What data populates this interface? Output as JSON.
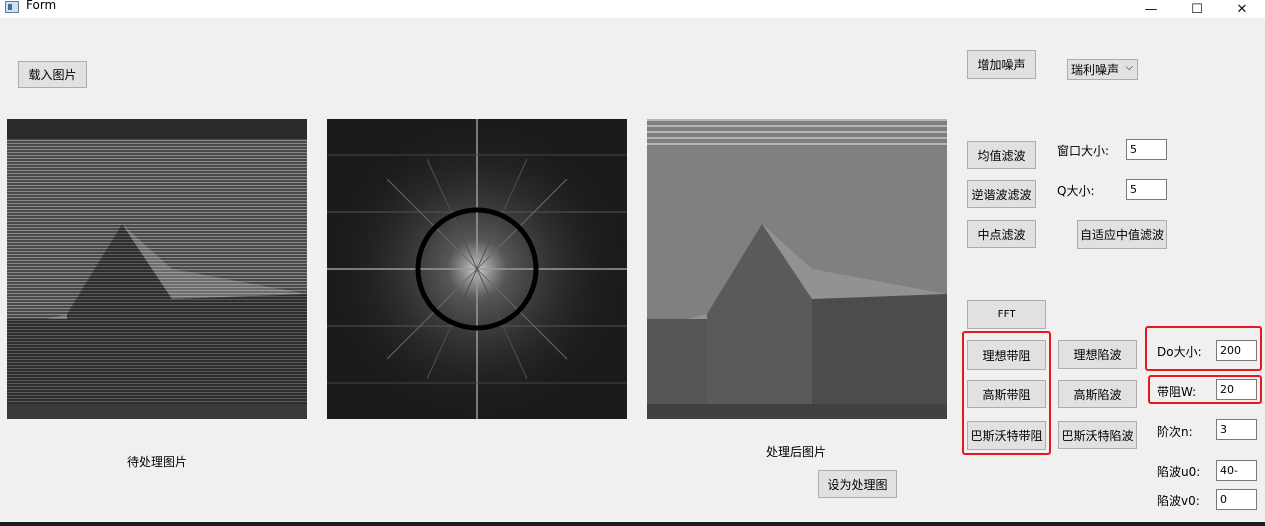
{
  "window": {
    "title": "Form",
    "minimize_glyph": "—",
    "maximize_glyph": "☐",
    "close_glyph": "✕"
  },
  "buttons": {
    "load_image": "载入图片",
    "add_noise": "增加噪声",
    "mean_filter": "均值滤波",
    "contraharmonic_filter": "逆谐波滤波",
    "midpoint_filter": "中点滤波",
    "adaptive_median_filter": "自适应中值滤波",
    "fft": "FFT",
    "ideal_bandstop": "理想带阻",
    "ideal_notch": "理想陷波",
    "gaussian_bandstop": "高斯带阻",
    "gaussian_notch": "高斯陷波",
    "butterworth_bandstop": "巴斯沃特带阻",
    "butterworth_notch": "巴斯沃特陷波",
    "set_as_source": "设为处理图"
  },
  "noise_select": {
    "value": "瑞利噪声"
  },
  "labels": {
    "window_size": "窗口大小:",
    "q_size": "Q大小:",
    "d0_size": "Do大小:",
    "band_width": "带阻W:",
    "order": "阶次n:",
    "notch_u0": "陷波u0:",
    "notch_v0": "陷波v0:",
    "source_caption": "待处理图片",
    "result_caption": "处理后图片"
  },
  "fields": {
    "window_size": "5",
    "q_size": "5",
    "d0_size": "200",
    "band_width": "20",
    "order": "3",
    "notch_u0": "40-",
    "notch_v0": "0"
  },
  "colors": {
    "highlight": "#e8161d",
    "window_bg": "#f0f0f0",
    "button_bg": "#e1e1e1"
  },
  "icons": {
    "app": "form-app-icon",
    "dropdown": "chevron-down-icon"
  }
}
